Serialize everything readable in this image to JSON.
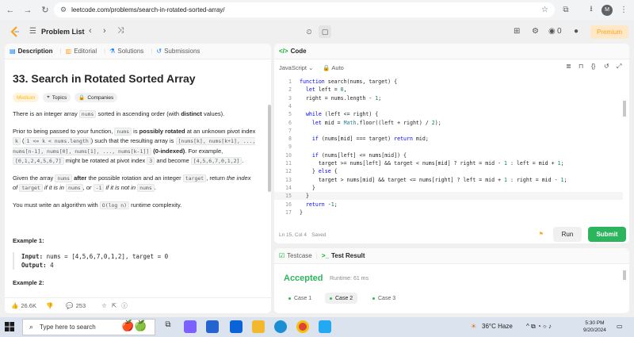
{
  "browser": {
    "url": "leetcode.com/problems/search-in-rotated-sorted-array/",
    "profile_initial": "M"
  },
  "nav": {
    "problem_list": "Problem List",
    "coins": "0",
    "premium": "Premium"
  },
  "tabs": {
    "description": "Description",
    "editorial": "Editorial",
    "solutions": "Solutions",
    "submissions": "Submissions"
  },
  "problem": {
    "title": "33. Search in Rotated Sorted Array",
    "difficulty": "Medium",
    "topics": "Topics",
    "companies": "Companies",
    "p1_a": "There is an integer array ",
    "p1_code": "nums",
    "p1_b": " sorted in ascending order (with ",
    "p1_bold": "distinct",
    "p1_c": " values).",
    "p2_a": "Prior to being passed to your function, ",
    "p2_code1": "nums",
    "p2_b": " is ",
    "p2_bold1": "possibly rotated",
    "p2_c": " at an unknown pivot index ",
    "p2_code2": "k",
    "p2_d": " (",
    "p2_code3": "1 <= k < nums.length",
    "p2_e": ") such that the resulting array is ",
    "p2_code4": "[nums[k], nums[k+1], ..., nums[n-1], nums[0], nums[1], ..., nums[k-1]]",
    "p2_f": " ",
    "p2_bold2": "(0-indexed)",
    "p2_g": ". For example, ",
    "p2_code5": "[0,1,2,4,5,6,7]",
    "p2_h": " might be rotated at pivot index ",
    "p2_code6": "3",
    "p2_i": " and become ",
    "p2_code7": "[4,5,6,7,0,1,2]",
    "p2_j": ".",
    "p3_a": "Given the array ",
    "p3_code1": "nums",
    "p3_bold": " after",
    "p3_b": " the possible rotation and an integer ",
    "p3_code2": "target",
    "p3_c": ", return ",
    "p3_it1": "the index of ",
    "p3_code3": "target",
    "p3_it2": " if it is in ",
    "p3_code4": "nums",
    "p3_it3": ", or ",
    "p3_code5": "-1",
    "p3_it4": " if it is not in ",
    "p3_code6": "nums",
    "p3_d": ".",
    "p4_a": "You must write an algorithm with ",
    "p4_code": "O(log n)",
    "p4_b": " runtime complexity.",
    "example1_title": "Example 1:",
    "example1_input_label": "Input:",
    "example1_input": " nums = [4,5,6,7,0,1,2], target = 0",
    "example1_output_label": "Output:",
    "example1_output": " 4",
    "example2_title": "Example 2:",
    "likes": "26.6K",
    "comments": "253"
  },
  "code": {
    "header": "Code",
    "language": "JavaScript",
    "mode": "Auto",
    "lines": [
      "function search(nums, target) {",
      "  let left = 0,",
      "  right = nums.length - 1;",
      "",
      "  while (left <= right) {",
      "    let mid = Math.floor((left + right) / 2);",
      "",
      "    if (nums[mid] === target) return mid;",
      "",
      "    if (nums[left] <= nums[mid]) {",
      "      target >= nums[left] && target < nums[mid] ? right = mid - 1 : left = mid + 1;",
      "    } else {",
      "      target > nums[mid] && target <= nums[right] ? left = mid + 1 : right = mid - 1;",
      "    }",
      "  }",
      "  return -1;",
      "}"
    ],
    "status": "Ln 15, Col 4",
    "saved": "Saved",
    "run": "Run",
    "submit": "Submit"
  },
  "result": {
    "testcase_tab": "Testcase",
    "result_tab": "Test Result",
    "status": "Accepted",
    "runtime": "Runtime: 61 ms",
    "cases": [
      "Case 1",
      "Case 2",
      "Case 3"
    ]
  },
  "taskbar": {
    "search_placeholder": "Type here to search",
    "weather": "36°C  Haze",
    "time": "5:30 PM",
    "date": "9/20/2024"
  },
  "colors": {
    "accepted": "#2db55d",
    "submit": "#2db55d",
    "premium": "#ffa116",
    "medium": "#ffb800"
  }
}
